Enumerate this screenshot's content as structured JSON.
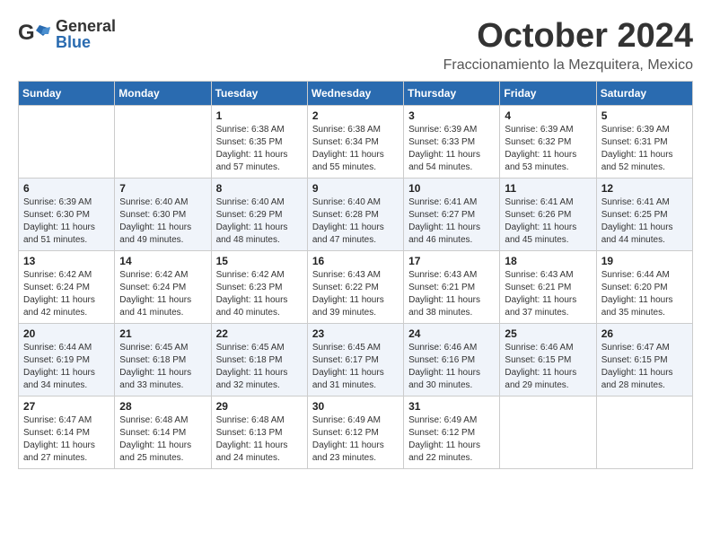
{
  "header": {
    "logo_general": "General",
    "logo_blue": "Blue",
    "month": "October 2024",
    "location": "Fraccionamiento la Mezquitera, Mexico"
  },
  "calendar": {
    "days_of_week": [
      "Sunday",
      "Monday",
      "Tuesday",
      "Wednesday",
      "Thursday",
      "Friday",
      "Saturday"
    ],
    "weeks": [
      [
        {
          "day": "",
          "info": ""
        },
        {
          "day": "",
          "info": ""
        },
        {
          "day": "1",
          "info": "Sunrise: 6:38 AM\nSunset: 6:35 PM\nDaylight: 11 hours\nand 57 minutes."
        },
        {
          "day": "2",
          "info": "Sunrise: 6:38 AM\nSunset: 6:34 PM\nDaylight: 11 hours\nand 55 minutes."
        },
        {
          "day": "3",
          "info": "Sunrise: 6:39 AM\nSunset: 6:33 PM\nDaylight: 11 hours\nand 54 minutes."
        },
        {
          "day": "4",
          "info": "Sunrise: 6:39 AM\nSunset: 6:32 PM\nDaylight: 11 hours\nand 53 minutes."
        },
        {
          "day": "5",
          "info": "Sunrise: 6:39 AM\nSunset: 6:31 PM\nDaylight: 11 hours\nand 52 minutes."
        }
      ],
      [
        {
          "day": "6",
          "info": "Sunrise: 6:39 AM\nSunset: 6:30 PM\nDaylight: 11 hours\nand 51 minutes."
        },
        {
          "day": "7",
          "info": "Sunrise: 6:40 AM\nSunset: 6:30 PM\nDaylight: 11 hours\nand 49 minutes."
        },
        {
          "day": "8",
          "info": "Sunrise: 6:40 AM\nSunset: 6:29 PM\nDaylight: 11 hours\nand 48 minutes."
        },
        {
          "day": "9",
          "info": "Sunrise: 6:40 AM\nSunset: 6:28 PM\nDaylight: 11 hours\nand 47 minutes."
        },
        {
          "day": "10",
          "info": "Sunrise: 6:41 AM\nSunset: 6:27 PM\nDaylight: 11 hours\nand 46 minutes."
        },
        {
          "day": "11",
          "info": "Sunrise: 6:41 AM\nSunset: 6:26 PM\nDaylight: 11 hours\nand 45 minutes."
        },
        {
          "day": "12",
          "info": "Sunrise: 6:41 AM\nSunset: 6:25 PM\nDaylight: 11 hours\nand 44 minutes."
        }
      ],
      [
        {
          "day": "13",
          "info": "Sunrise: 6:42 AM\nSunset: 6:24 PM\nDaylight: 11 hours\nand 42 minutes."
        },
        {
          "day": "14",
          "info": "Sunrise: 6:42 AM\nSunset: 6:24 PM\nDaylight: 11 hours\nand 41 minutes."
        },
        {
          "day": "15",
          "info": "Sunrise: 6:42 AM\nSunset: 6:23 PM\nDaylight: 11 hours\nand 40 minutes."
        },
        {
          "day": "16",
          "info": "Sunrise: 6:43 AM\nSunset: 6:22 PM\nDaylight: 11 hours\nand 39 minutes."
        },
        {
          "day": "17",
          "info": "Sunrise: 6:43 AM\nSunset: 6:21 PM\nDaylight: 11 hours\nand 38 minutes."
        },
        {
          "day": "18",
          "info": "Sunrise: 6:43 AM\nSunset: 6:21 PM\nDaylight: 11 hours\nand 37 minutes."
        },
        {
          "day": "19",
          "info": "Sunrise: 6:44 AM\nSunset: 6:20 PM\nDaylight: 11 hours\nand 35 minutes."
        }
      ],
      [
        {
          "day": "20",
          "info": "Sunrise: 6:44 AM\nSunset: 6:19 PM\nDaylight: 11 hours\nand 34 minutes."
        },
        {
          "day": "21",
          "info": "Sunrise: 6:45 AM\nSunset: 6:18 PM\nDaylight: 11 hours\nand 33 minutes."
        },
        {
          "day": "22",
          "info": "Sunrise: 6:45 AM\nSunset: 6:18 PM\nDaylight: 11 hours\nand 32 minutes."
        },
        {
          "day": "23",
          "info": "Sunrise: 6:45 AM\nSunset: 6:17 PM\nDaylight: 11 hours\nand 31 minutes."
        },
        {
          "day": "24",
          "info": "Sunrise: 6:46 AM\nSunset: 6:16 PM\nDaylight: 11 hours\nand 30 minutes."
        },
        {
          "day": "25",
          "info": "Sunrise: 6:46 AM\nSunset: 6:15 PM\nDaylight: 11 hours\nand 29 minutes."
        },
        {
          "day": "26",
          "info": "Sunrise: 6:47 AM\nSunset: 6:15 PM\nDaylight: 11 hours\nand 28 minutes."
        }
      ],
      [
        {
          "day": "27",
          "info": "Sunrise: 6:47 AM\nSunset: 6:14 PM\nDaylight: 11 hours\nand 27 minutes."
        },
        {
          "day": "28",
          "info": "Sunrise: 6:48 AM\nSunset: 6:14 PM\nDaylight: 11 hours\nand 25 minutes."
        },
        {
          "day": "29",
          "info": "Sunrise: 6:48 AM\nSunset: 6:13 PM\nDaylight: 11 hours\nand 24 minutes."
        },
        {
          "day": "30",
          "info": "Sunrise: 6:49 AM\nSunset: 6:12 PM\nDaylight: 11 hours\nand 23 minutes."
        },
        {
          "day": "31",
          "info": "Sunrise: 6:49 AM\nSunset: 6:12 PM\nDaylight: 11 hours\nand 22 minutes."
        },
        {
          "day": "",
          "info": ""
        },
        {
          "day": "",
          "info": ""
        }
      ]
    ]
  }
}
